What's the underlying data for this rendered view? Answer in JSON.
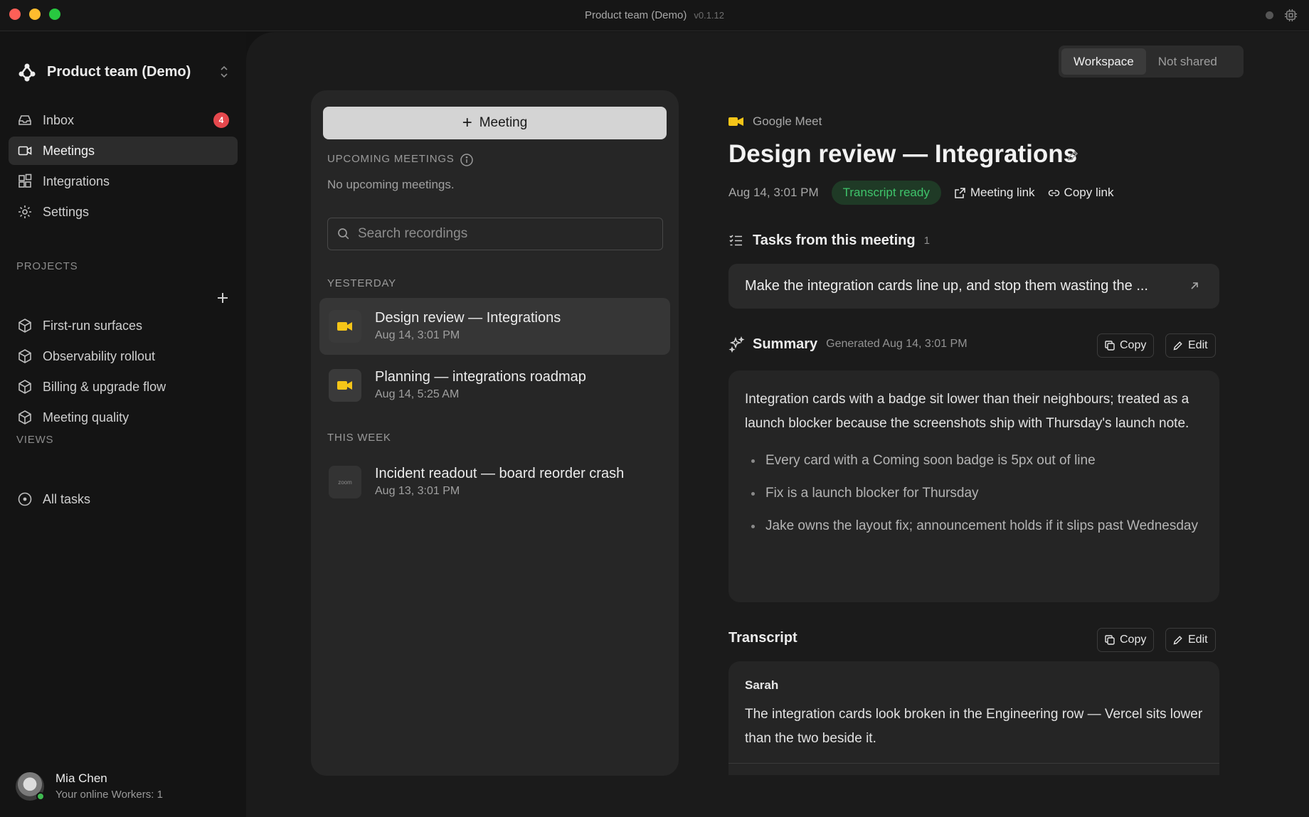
{
  "window": {
    "title": "Product team (Demo)",
    "version": "v0.1.12"
  },
  "sidebar": {
    "team_name": "Product team (Demo)",
    "nav": [
      {
        "label": "Inbox",
        "icon": "inbox-icon",
        "badge": "4"
      },
      {
        "label": "Meetings",
        "icon": "video-icon",
        "active": true
      },
      {
        "label": "Integrations",
        "icon": "integrations-icon"
      },
      {
        "label": "Settings",
        "icon": "gear-icon"
      }
    ],
    "projects_header": "PROJECTS",
    "projects": [
      {
        "label": "First-run surfaces",
        "icon": "cube-icon"
      },
      {
        "label": "Observability rollout",
        "icon": "cube-icon"
      },
      {
        "label": "Billing & upgrade flow",
        "icon": "cube-icon"
      },
      {
        "label": "Meeting quality",
        "icon": "cube-icon"
      }
    ],
    "views_header": "VIEWS",
    "views": [
      {
        "label": "All tasks",
        "icon": "circle-dot-icon"
      }
    ],
    "user": {
      "name": "Mia Chen",
      "status": "Your online Workers: 1"
    }
  },
  "scope_toggle": {
    "options": [
      "Workspace",
      "Not shared"
    ],
    "selected": "Workspace"
  },
  "meetings_panel": {
    "new_button": "Meeting",
    "upcoming_header": "UPCOMING MEETINGS",
    "upcoming_empty": "No upcoming meetings.",
    "search_placeholder": "Search recordings",
    "groups": [
      {
        "label": "YESTERDAY",
        "items": [
          {
            "title": "Design review — Integrations",
            "date": "Aug 14, 3:01 PM",
            "source": "google-meet",
            "active": true
          },
          {
            "title": "Planning — integrations roadmap",
            "date": "Aug 14, 5:25 AM",
            "source": "google-meet"
          }
        ]
      },
      {
        "label": "THIS WEEK",
        "items": [
          {
            "title": "Incident readout — board reorder crash",
            "date": "Aug 13, 3:01 PM",
            "source": "zoom",
            "source_label": "zoom"
          }
        ]
      }
    ]
  },
  "detail": {
    "source": "Google Meet",
    "title": "Design review — Integrations",
    "date": "Aug 14, 3:01 PM",
    "status": "Transcript ready",
    "meeting_link": "Meeting link",
    "copy_link": "Copy link",
    "tasks_header": "Tasks from this meeting",
    "tasks_count": "1",
    "task_text": "Make the integration cards line up, and stop them wasting the ...",
    "summary_header": "Summary",
    "summary_generated": "Generated Aug 14, 3:01 PM",
    "copy_label": "Copy",
    "edit_label": "Edit",
    "summary_text": "Integration cards with a badge sit lower than their neighbours; treated as a launch blocker because the screenshots ship with Thursday's launch note.",
    "summary_bullets": [
      "Every card with a Coming soon badge is 5px out of line",
      "Fix is a launch blocker for Thursday",
      "Jake owns the layout fix; announcement holds if it slips past Wednesday"
    ],
    "transcript_header": "Transcript",
    "transcript": [
      {
        "speaker": "Sarah",
        "text": "The integration cards look broken in the Engineering row — Vercel sits lower than the two beside it."
      }
    ]
  },
  "colors": {
    "accent_yellow": "#f5c518",
    "badge_red": "#e5484d",
    "status_green": "#3fc46b",
    "panel_bg": "#262626"
  }
}
